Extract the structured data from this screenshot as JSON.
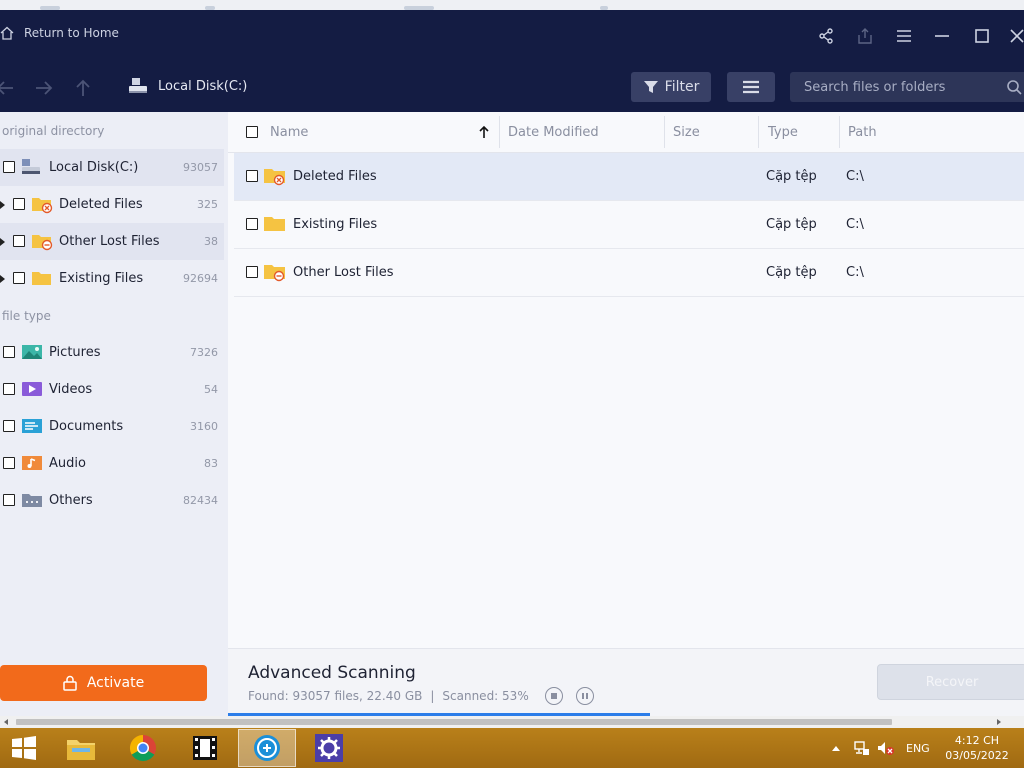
{
  "titlebar": {
    "home_label": "Return to Home"
  },
  "navbar": {
    "breadcrumb": "Local Disk(C:)",
    "filter_label": "Filter",
    "search_placeholder": "Search files or folders"
  },
  "sidebar": {
    "section_directory": "original directory",
    "directory": [
      {
        "label": "Local Disk(C:)",
        "count": "93057"
      },
      {
        "label": "Deleted Files",
        "count": "325"
      },
      {
        "label": "Other Lost Files",
        "count": "38"
      },
      {
        "label": "Existing Files",
        "count": "92694"
      }
    ],
    "section_filetype": "file type",
    "filetypes": [
      {
        "label": "Pictures",
        "count": "7326"
      },
      {
        "label": "Videos",
        "count": "54"
      },
      {
        "label": "Documents",
        "count": "3160"
      },
      {
        "label": "Audio",
        "count": "83"
      },
      {
        "label": "Others",
        "count": "82434"
      }
    ],
    "activate_label": "Activate"
  },
  "table": {
    "columns": {
      "name": "Name",
      "date": "Date Modified",
      "size": "Size",
      "type": "Type",
      "path": "Path"
    },
    "rows": [
      {
        "name": "Deleted Files",
        "type": "Cặp tệp",
        "path": "C:\\"
      },
      {
        "name": "Existing Files",
        "type": "Cặp tệp",
        "path": "C:\\"
      },
      {
        "name": "Other Lost Files",
        "type": "Cặp tệp",
        "path": "C:\\"
      }
    ]
  },
  "status": {
    "title": "Advanced Scanning",
    "found": "Found: 93057 files, 22.40 GB",
    "separator": "|",
    "scanned": "Scanned: 53%",
    "progress": 0.53,
    "recover_label": "Recover"
  },
  "taskbar": {
    "language": "ENG",
    "time": "4:12 CH",
    "date": "03/05/2022"
  },
  "colors": {
    "header_bg": "#141c43",
    "accent_orange": "#f26a1b",
    "progress_blue": "#2b7de9"
  }
}
